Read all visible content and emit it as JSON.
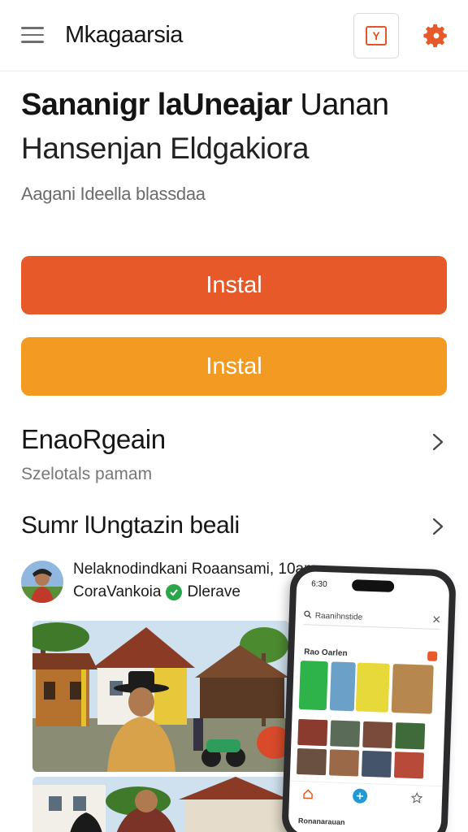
{
  "header": {
    "app_title": "Mkagaarsia",
    "badge_glyph": "Y",
    "menu_icon": "hamburger-menu-icon",
    "settings_icon": "gear-icon",
    "accent": "#e8592a"
  },
  "hero": {
    "headline_bold": "Sananigr laUneajar",
    "headline_light": "Uanan",
    "headline_line2": "Hansenjan Eldgakiora",
    "subtitle": "Aagani Ideella blassdaa"
  },
  "buttons": {
    "primary_label": "Instal",
    "primary_color": "#e8592a",
    "secondary_label": "Instal",
    "secondary_color": "#f39a23"
  },
  "section1": {
    "title": "EnaoRgeain",
    "subtitle": "Szelotals pamam"
  },
  "section2": {
    "title": "Sumr lUngtazin beali"
  },
  "post": {
    "author_line": "Nelaknodindkani Roaansami, 10am",
    "meta_name": "CoraVankoia",
    "meta_tag": "Dlerave",
    "verified_color": "#2aa54a"
  },
  "phone": {
    "time": "6:30",
    "search_text": "Raanihnstide",
    "section_label": "Rao Oarlen",
    "bottom_label": "Ronanarauan"
  }
}
